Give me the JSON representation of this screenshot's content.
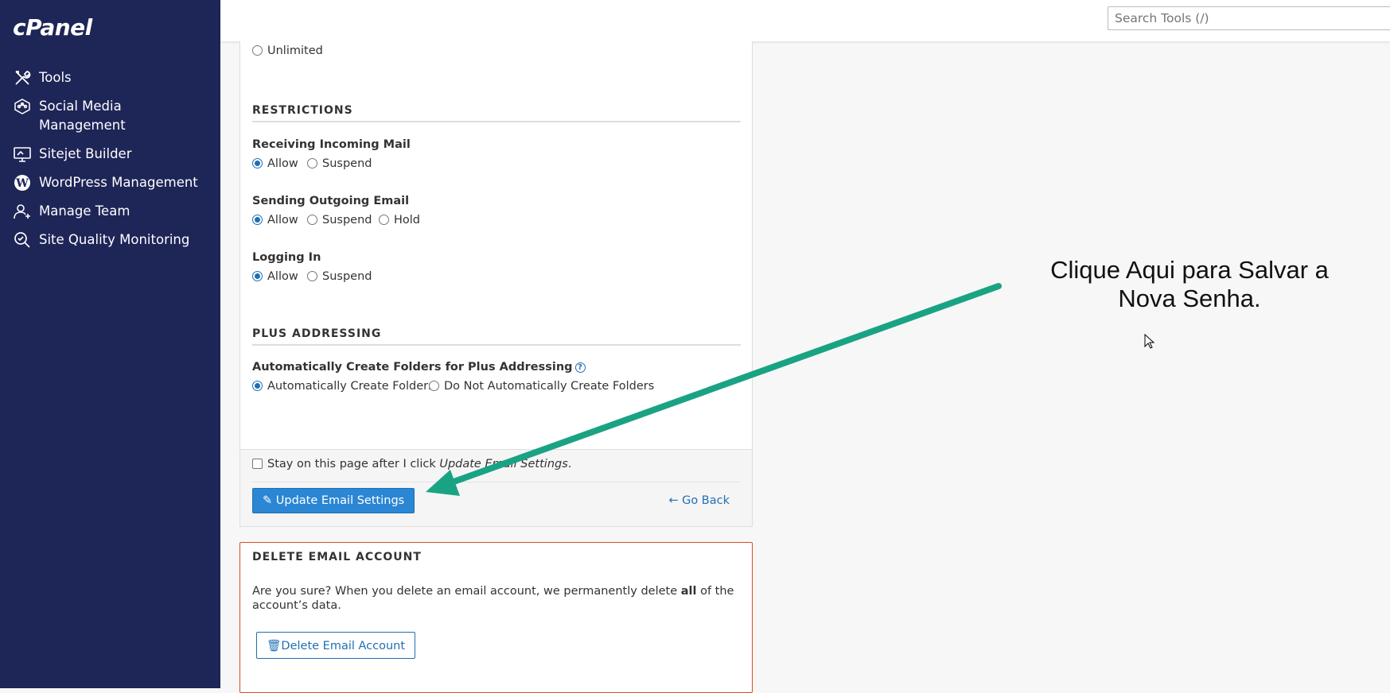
{
  "app": {
    "logo": "cPanel"
  },
  "search": {
    "placeholder": "Search Tools (/)"
  },
  "sidebar": {
    "items": [
      {
        "label": "Tools",
        "icon": "tools-icon"
      },
      {
        "label": "Social Media Management",
        "icon": "social-media-icon"
      },
      {
        "label": "Sitejet Builder",
        "icon": "monitor-icon"
      },
      {
        "label": "WordPress Management",
        "icon": "wordpress-icon"
      },
      {
        "label": "Manage Team",
        "icon": "team-icon"
      },
      {
        "label": "Site Quality Monitoring",
        "icon": "magnifier-check-icon"
      }
    ]
  },
  "quota": {
    "unlimited_label": "Unlimited",
    "unlimited_selected": false
  },
  "restrictions": {
    "title": "RESTRICTIONS",
    "receiving": {
      "label": "Receiving Incoming Mail",
      "allow": "Allow",
      "suspend": "Suspend",
      "selected": "allow"
    },
    "sending": {
      "label": "Sending Outgoing Email",
      "allow": "Allow",
      "suspend": "Suspend",
      "hold": "Hold",
      "selected": "allow"
    },
    "login": {
      "label": "Logging In",
      "allow": "Allow",
      "suspend": "Suspend",
      "selected": "allow"
    }
  },
  "plus_addressing": {
    "title": "PLUS ADDRESSING",
    "label": "Automatically Create Folders for Plus Addressing",
    "auto": "Automatically Create Folders",
    "no_auto": "Do Not Automatically Create Folders",
    "selected": "auto"
  },
  "footer": {
    "stay_prefix": "Stay on this page after I click ",
    "stay_emph": "Update Email Settings",
    "stay_suffix": ".",
    "stay_checked": false,
    "update_button": "Update Email Settings",
    "go_back": "Go Back"
  },
  "delete": {
    "title": "DELETE EMAIL ACCOUNT",
    "text_prefix": "Are you sure? When you delete an email account, we permanently delete ",
    "text_bold": "all",
    "text_suffix": " of the account’s data.",
    "button": "Delete Email Account"
  },
  "annotation": {
    "text": "Clique Aqui para Salvar a Nova Senha."
  },
  "colors": {
    "sidebar_bg": "#1e2557",
    "primary": "#2b86d4",
    "danger_border": "#d4501e",
    "arrow": "#1aa383"
  }
}
